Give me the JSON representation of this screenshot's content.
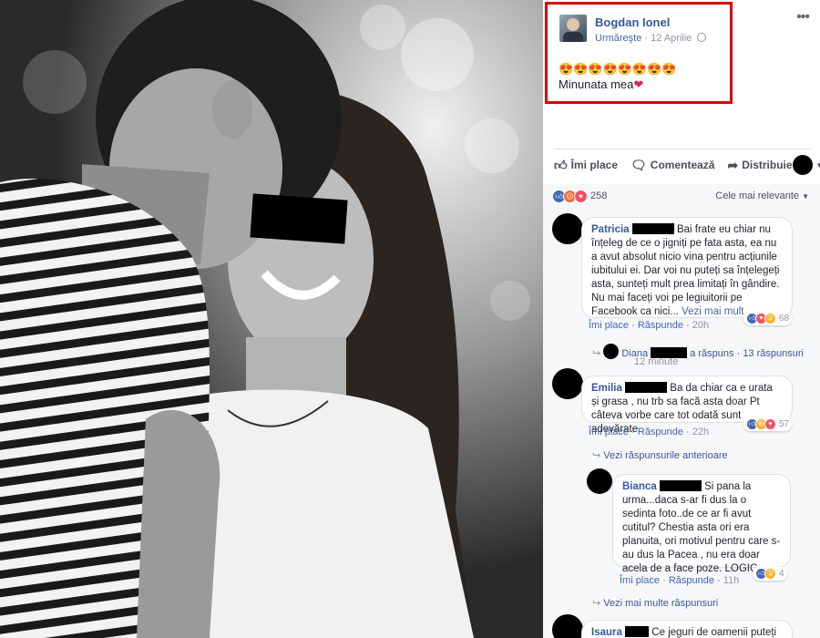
{
  "post": {
    "author": "Bogdan Ionel",
    "follow_label": "Urmăreşte",
    "date": "12 Aprilie",
    "emojis": "😍😍😍😍😍😍😍😍",
    "text": "Minunata mea",
    "text_emoji": "❤",
    "more_label": "•••"
  },
  "actions": {
    "like": "Îmi place",
    "comment": "Comentează",
    "share": "Distribuie"
  },
  "reactions": {
    "count": "258",
    "sort_label": "Cele mai relevante",
    "icons": [
      "like-icon",
      "angry-icon",
      "love-icon"
    ]
  },
  "colors": {
    "link": "#365899",
    "accent": "#4267b2",
    "highlight_border": "#d90000"
  },
  "comments": [
    {
      "name": "Patricia",
      "text": "Bai frate eu chiar nu înțeleg de ce o jigniți pe fata asta, ea nu a avut absolut nicio vina pentru acțiunile iubitului ei. Dar voi nu puteți sa înțelegeți asta, sunteți mult prea limitați în gândire. Nu mai faceți voi pe legiuitorii pe Facebook ca nici...",
      "see_more": "Vezi mai mult",
      "like": "Îmi place",
      "reply": "Răspunde",
      "time": "20h",
      "reaction_count": "68",
      "reply_summary": {
        "name": "Diana",
        "action": "a răspuns",
        "count": "13 răspunsuri",
        "time": "12 minute"
      }
    },
    {
      "name": "Emilia",
      "text": "Ba da chiar ca e urata și grasa , nu trb sa facă asta doar Pt câteva vorbe care tot odată sunt adevărate",
      "like": "Îmi place",
      "reply": "Răspunde",
      "time": "22h",
      "reaction_count": "57",
      "previous_replies": "Vezi răspunsurile anterioare",
      "more_replies": "Vezi mai multe răspunsuri"
    },
    {
      "name": "Bianca",
      "text": "Si pana la urma...daca s-ar fi dus la o sedinta foto..de ce ar fi avut cutitul? Chestia asta ori era planuita, ori motivul pentru care s-au dus la Pacea , nu era doar acela de a face poze. LOGIC",
      "like": "Îmi place",
      "reply": "Răspunde",
      "time": "11h",
      "reaction_count": "4"
    },
    {
      "name": "Isaura",
      "text": "Ce jeguri de oamenii puteți fii,"
    }
  ]
}
